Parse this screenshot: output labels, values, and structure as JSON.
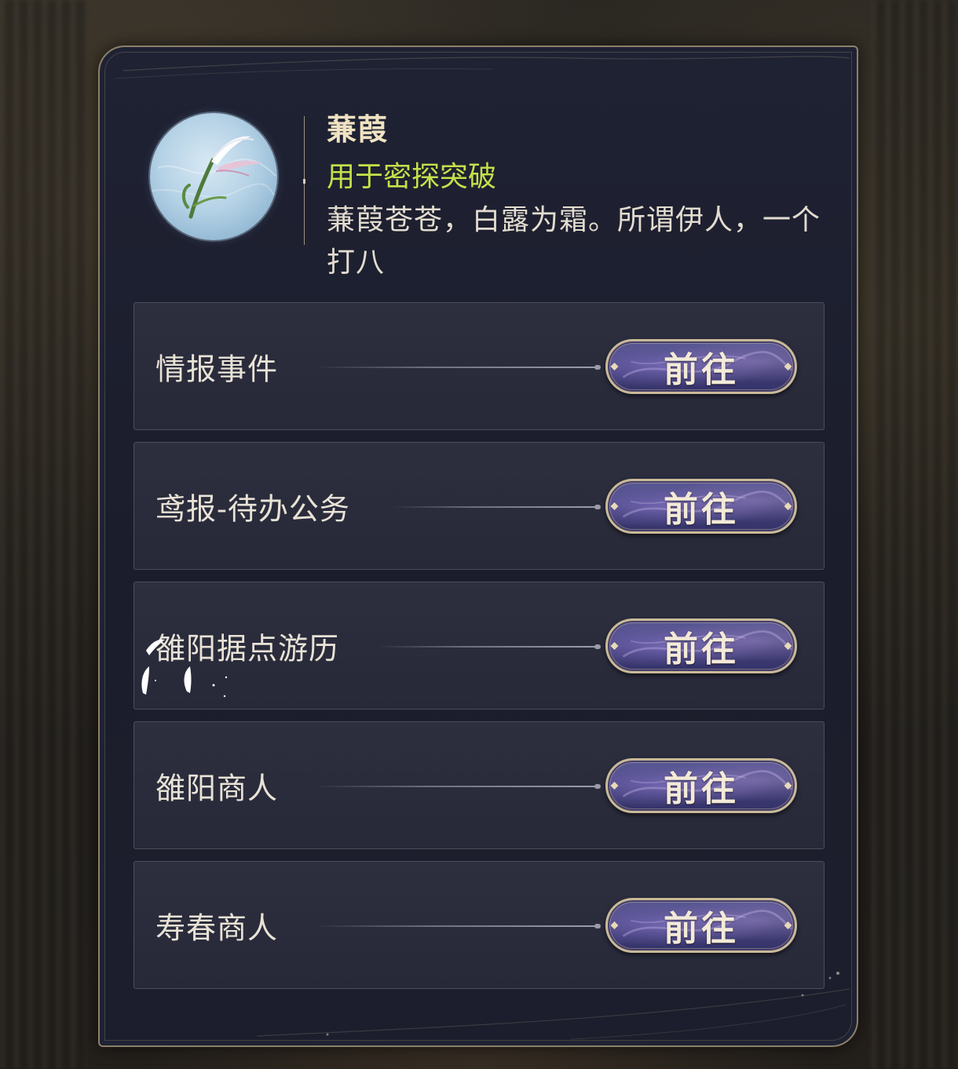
{
  "item": {
    "name": "蒹葭",
    "usage": "用于密探突破",
    "description": "蒹葭苍苍，白露为霜。所谓伊人，一个打八",
    "icon": "reed-feather-icon"
  },
  "sources": [
    {
      "label": "情报事件",
      "button": "前往"
    },
    {
      "label": "鸢报-待办公务",
      "button": "前往"
    },
    {
      "label": "雒阳据点游历",
      "button": "前往"
    },
    {
      "label": "雒阳商人",
      "button": "前往"
    },
    {
      "label": "寿春商人",
      "button": "前往"
    }
  ],
  "colors": {
    "usage_text": "#c6e04a",
    "name_text": "#f0e2c2",
    "panel_border": "#8c806a",
    "button_fill": "#3e3c73"
  }
}
